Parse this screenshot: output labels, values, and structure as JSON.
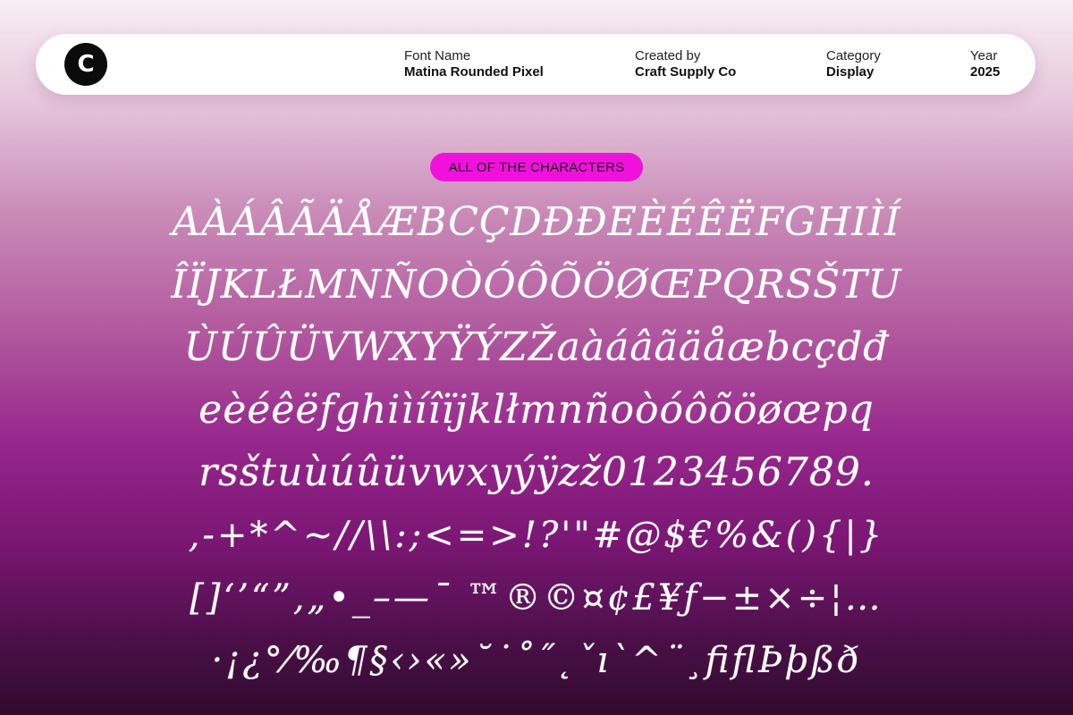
{
  "header": {
    "logo_letter": "C",
    "font_name_label": "Font Name",
    "font_name_value": "Matina Rounded Pixel",
    "created_by_label": "Created by",
    "created_by_value": "Craft Supply Co",
    "category_label": "Category",
    "category_value": "Display",
    "year_label": "Year",
    "year_value": "2025"
  },
  "badge": {
    "label": "ALL OF THE CHARACTERS",
    "color": "#f012dc"
  },
  "characters": {
    "rows": [
      "AÀÁÂÃÄÅÆBCÇDĐÐEÈÉÊËFGHIÌÍ",
      "ÎÏJKLŁMNÑOÒÓÔÕÖØŒPQRSŠTU",
      "ÙÚÛÜVWXYŸÝZŽaàáâãäåæbcçdđ",
      "eèéêëfghiìíîïjklłmnñoòóôõöøœpq",
      "rsštuùúûüvwxyýÿzž0123456789.",
      ",-+*^~//\\\\:;<=>!?'\"#@$€%&(){|}",
      "[]‘’“”,„•_–—ˉ ™®©¤¢£¥ƒ−±×÷¦…",
      "·¡¿°⁄‰¶§‹›«»˘˙˚˝˛ˇı`^¨¸ﬁﬂÞþßð"
    ]
  }
}
